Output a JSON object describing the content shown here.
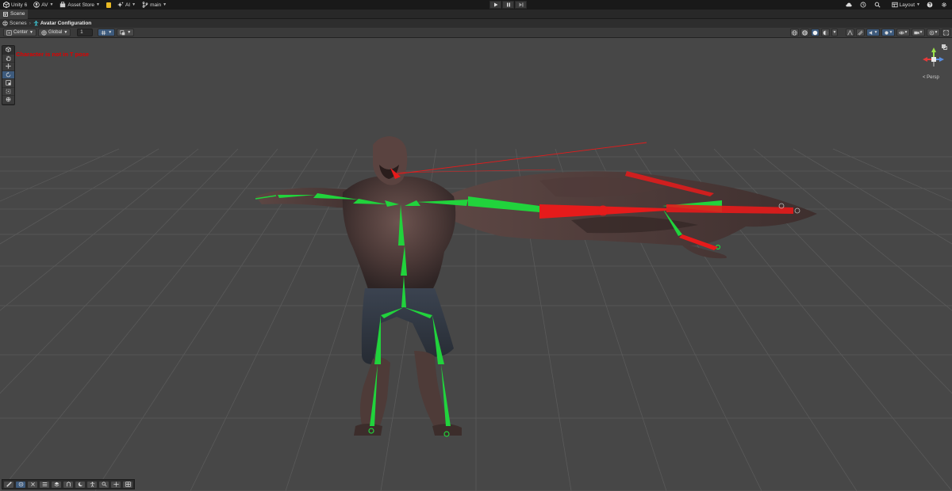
{
  "topbar": {
    "app": "Unity 6",
    "account": "AV",
    "asset_store": "Asset Store",
    "ai": "AI",
    "branch": "main",
    "layout": "Layout"
  },
  "tabbar": {
    "scene_tab": "Scene"
  },
  "breadcrumb": {
    "root": "Scenes",
    "current": "Avatar Configuration"
  },
  "scene_toolbar": {
    "pivot": "Center",
    "space": "Global",
    "snap_value": "1"
  },
  "viewport": {
    "warning": "Character is not in T pose",
    "projection": "< Persp"
  },
  "colors": {
    "bone_valid": "#21d33c",
    "bone_invalid": "#e61b1b",
    "viewport_bg": "#474747",
    "grid": "#5e5e5e",
    "active_tool": "#3d5a7c"
  }
}
